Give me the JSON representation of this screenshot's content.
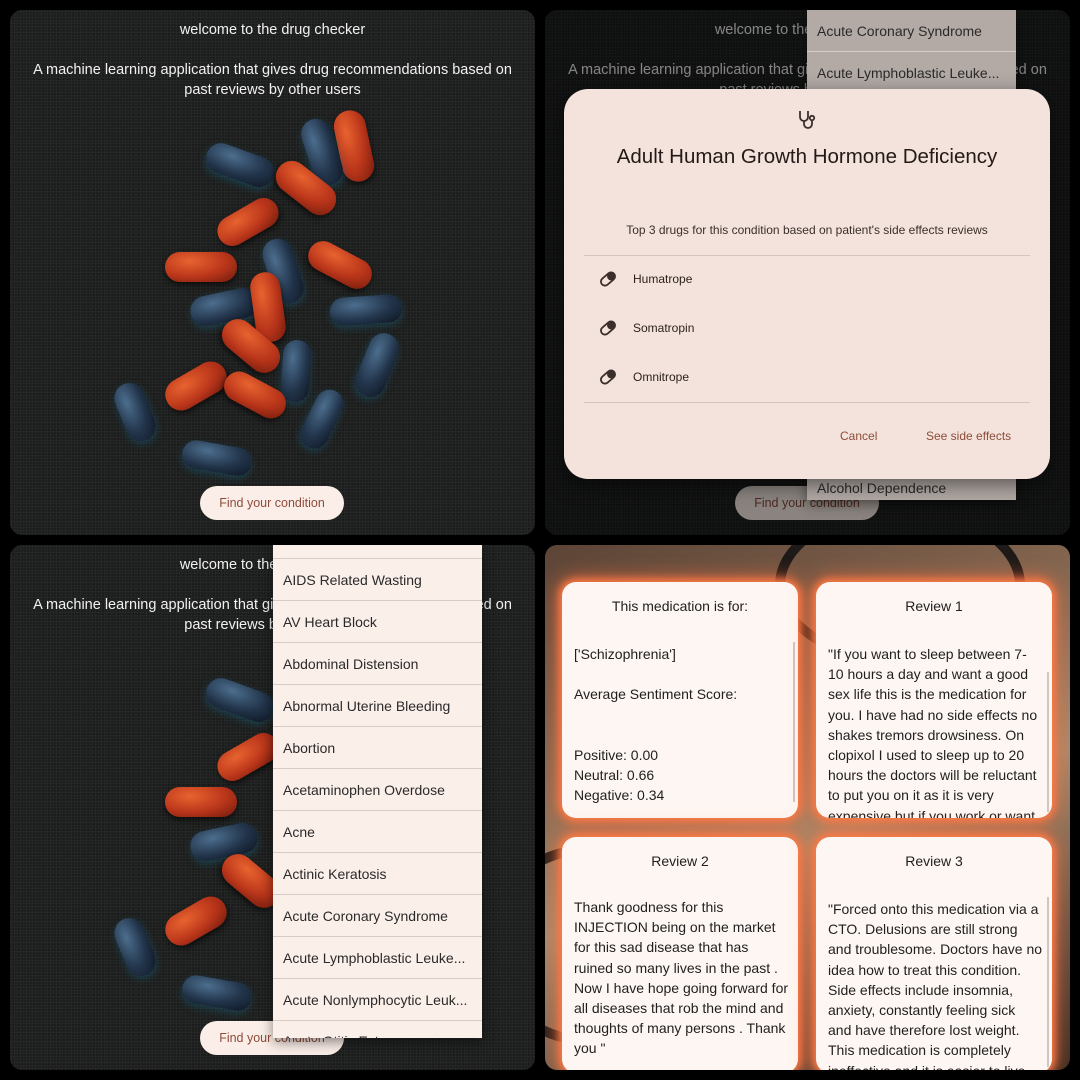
{
  "landing": {
    "title": "welcome to the drug checker",
    "subtitle": "A machine learning application that gives drug recommendations based on past reviews by other users",
    "find_button": "Find your condition",
    "colors": {
      "button_bg": "#fbeee8",
      "button_text": "#8d4c3a"
    }
  },
  "dialog": {
    "icon": "stethoscope-icon",
    "title": "Adult Human Growth Hormone Deficiency",
    "subtitle": "Top 3 drugs for this condition based on patient's side effects reviews",
    "drugs": [
      {
        "icon": "pill-icon",
        "label": "Humatrope"
      },
      {
        "icon": "pill-icon",
        "label": "Somatropin"
      },
      {
        "icon": "pill-icon",
        "label": "Omnitrope"
      }
    ],
    "cancel": "Cancel",
    "side_effects": "See side effects",
    "behind_menu": [
      "Acute Coronary Syndrome",
      "Acute Lymphoblastic Leuke...",
      "Alcohol Dependence"
    ]
  },
  "dropdown": {
    "items": [
      "AIDS Related Wasting",
      "AV Heart Block",
      "Abdominal Distension",
      "Abnormal Uterine Bleeding",
      "Abortion",
      "Acetaminophen Overdose",
      "Acne",
      "Actinic Keratosis",
      "Acute Coronary Syndrome",
      "Acute Lymphoblastic Leuke...",
      "Acute Nonlymphocytic Leuk...",
      "Acute Otitis Externa"
    ]
  },
  "results": {
    "info_card": {
      "title": "This medication is for:",
      "condition": "['Schizophrenia']",
      "avg_label": "Average Sentiment Score:",
      "positive": "Positive: 0.00",
      "neutral": "Neutral: 0.66",
      "negative": "Negative: 0.34"
    },
    "reviews": [
      {
        "title": "Review 1",
        "text": "\"If you  want to sleep between 7-10 hours a day and want a good sex life this is the medication for you. I have had no side effects no shakes tremors drowsiness. On clopixol I used to sleep up to 20 hours the doctors will be reluctant to put you on it  as it is very expensive but if you work or want"
      },
      {
        "title": "Review 2",
        "text": "Thank goodness for this INJECTION being on the market for this sad disease that has ruined so many lives in the past . Now I have hope going forward for all diseases that rob the mind and thoughts of many persons . Thank you \""
      },
      {
        "title": "Review 3",
        "text": "\"Forced onto this medication via a CTO. Delusions are still strong and troublesome. Doctors have no idea how to treat this condition. Side effects include insomnia, anxiety, constantly feeling sick and have therefore lost weight. This medication is completely ineffective and it is easier to live"
      }
    ],
    "colors": {
      "card_bg": "#fef6f2",
      "glow": "#ff7a45"
    }
  }
}
